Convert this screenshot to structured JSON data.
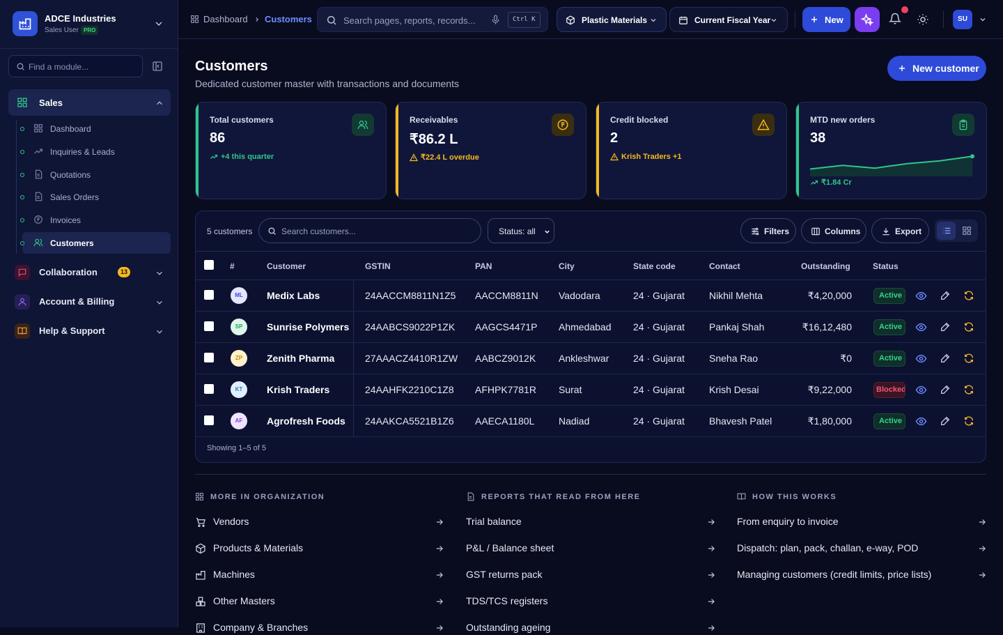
{
  "brand": {
    "name": "ADCE Industries",
    "role": "Sales User",
    "badge": "PRO"
  },
  "sidebar": {
    "find_placeholder": "Find a module...",
    "sales_label": "Sales",
    "sales_items": [
      {
        "label": "Dashboard",
        "icon": "grid-icon"
      },
      {
        "label": "Inquiries & Leads",
        "icon": "trend-icon"
      },
      {
        "label": "Quotations",
        "icon": "doc-icon"
      },
      {
        "label": "Sales Orders",
        "icon": "doc-icon"
      },
      {
        "label": "Invoices",
        "icon": "coin-icon"
      },
      {
        "label": "Customers",
        "icon": "users-icon",
        "active": true
      }
    ],
    "groups": [
      {
        "label": "Collaboration",
        "count": "13",
        "icon": "chat-icon",
        "color": "#e8486e"
      },
      {
        "label": "Account & Billing",
        "icon": "user-icon",
        "color": "#8b6cf0"
      },
      {
        "label": "Help & Support",
        "icon": "book-icon",
        "color": "#f59a3c"
      }
    ]
  },
  "topbar": {
    "crumbs": [
      "Dashboard",
      "Customers"
    ],
    "search_placeholder": "Search pages, reports, records...",
    "search_shortcut": "Ctrl K",
    "division": "Plastic Materials",
    "period": "Current Fiscal Year",
    "new_label": "New",
    "avatar": "SU"
  },
  "page": {
    "title": "Customers",
    "subtitle": "Dedicated customer master with transactions and documents",
    "new_customer": "New customer"
  },
  "kpis": [
    {
      "label": "Total customers",
      "value": "86",
      "note": "+4 this quarter",
      "accent": "#2fc78a"
    },
    {
      "label": "Receivables",
      "value": "₹86.2 L",
      "note": "₹22.4 L overdue",
      "accent": "#f5b820"
    },
    {
      "label": "Credit blocked",
      "value": "2",
      "note": "Krish Traders +1",
      "accent": "#f5b820"
    },
    {
      "label": "MTD new orders",
      "value": "38",
      "note": "₹1.84 Cr",
      "accent": "#2fc78a",
      "sparkline": [
        0.25,
        0.45,
        0.3,
        0.55,
        0.7,
        0.95
      ]
    }
  ],
  "table": {
    "count_label": "5 customers",
    "search_placeholder": "Search customers...",
    "status_filter": "Status: all",
    "filters": "Filters",
    "columns_btn": "Columns",
    "export": "Export",
    "headers": [
      "#",
      "Customer",
      "GSTIN",
      "PAN",
      "City",
      "State code",
      "Contact",
      "Outstanding",
      "Status"
    ],
    "rows": [
      {
        "initials": "ML",
        "name": "Medix Labs",
        "gstin": "24AACCM8811N1Z5",
        "pan": "AACCM8811N",
        "city": "Vadodara",
        "state": "24 · Gujarat",
        "contact": "Nikhil Mehta",
        "outstanding": "₹4,20,000",
        "status": "Active"
      },
      {
        "initials": "SP",
        "name": "Sunrise Polymers",
        "gstin": "24AABCS9022P1ZK",
        "pan": "AAGCS4471P",
        "city": "Ahmedabad",
        "state": "24 · Gujarat",
        "contact": "Pankaj Shah",
        "outstanding": "₹16,12,480",
        "status": "Active"
      },
      {
        "initials": "ZP",
        "name": "Zenith Pharma",
        "gstin": "27AAACZ4410R1ZW",
        "pan": "AABCZ9012K",
        "city": "Ankleshwar",
        "state": "24 · Gujarat",
        "contact": "Sneha Rao",
        "outstanding": "₹0",
        "status": "Active"
      },
      {
        "initials": "KT",
        "name": "Krish Traders",
        "gstin": "24AAHFK2210C1Z8",
        "pan": "AFHPK7781R",
        "city": "Surat",
        "state": "24 · Gujarat",
        "contact": "Krish Desai",
        "outstanding": "₹9,22,000",
        "status": "Blocked"
      },
      {
        "initials": "AF",
        "name": "Agrofresh Foods",
        "gstin": "24AAKCA5521B1Z6",
        "pan": "AAECA1180L",
        "city": "Nadiad",
        "state": "24 · Gujarat",
        "contact": "Bhavesh Patel",
        "outstanding": "₹1,80,000",
        "status": "Active"
      }
    ],
    "footer": "Showing 1–5 of 5"
  },
  "bottom": {
    "more_title": "MORE IN ORGANIZATION",
    "more_links": [
      "Vendors",
      "Products & Materials",
      "Machines",
      "Other Masters",
      "Company & Branches"
    ],
    "reports_title": "REPORTS THAT READ FROM HERE",
    "reports_links": [
      "Trial balance",
      "P&L / Balance sheet",
      "GST returns pack",
      "TDS/TCS registers",
      "Outstanding ageing"
    ],
    "how_title": "HOW THIS WORKS",
    "how_links": [
      "From enquiry to invoice",
      "Dispatch: plan, pack, challan, e-way, POD",
      "Managing customers (credit limits, price lists)"
    ]
  }
}
